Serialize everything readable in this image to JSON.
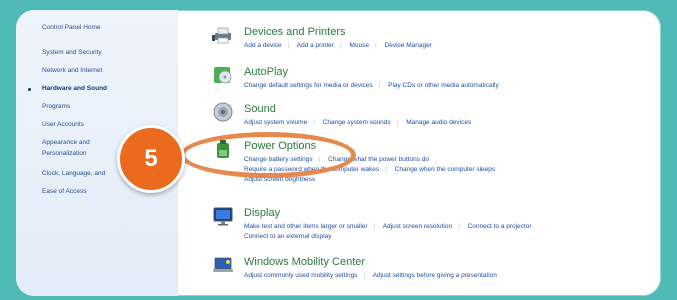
{
  "sidebar": {
    "items": [
      {
        "label": "Control Panel Home"
      },
      {
        "label": "System and Security"
      },
      {
        "label": "Network and Internet"
      },
      {
        "label": "Hardware and Sound"
      },
      {
        "label": "Programs"
      },
      {
        "label": "User Accounts"
      },
      {
        "label": "Appearance and"
      },
      {
        "label": "Personalization"
      },
      {
        "label": "Clock, Language, and"
      },
      {
        "label": "Ease of Access"
      }
    ]
  },
  "categories": [
    {
      "title": "Devices and Printers",
      "icon": "printer-icon",
      "links": [
        "Add a device",
        "Add a printer",
        "Mouse",
        "Device Manager"
      ]
    },
    {
      "title": "AutoPlay",
      "icon": "autoplay-icon",
      "links": [
        "Change default settings for media or devices",
        "Play CDs or other media automatically"
      ]
    },
    {
      "title": "Sound",
      "icon": "speaker-icon",
      "links": [
        "Adjust system volume",
        "Change system sounds",
        "Manage audio devices"
      ]
    },
    {
      "title": "Power Options",
      "icon": "battery-icon",
      "links": [
        "Change battery settings",
        "Change what the power buttons do"
      ],
      "links2": [
        "Require a password when the computer wakes",
        "Change when the computer sleeps"
      ],
      "links3": [
        "Adjust screen brightness"
      ]
    },
    {
      "title": "Display",
      "icon": "monitor-icon",
      "links": [
        "Make text and other items larger or smaller",
        "Adjust screen resolution",
        "Connect to a projector"
      ],
      "links2": [
        "Connect to an external display"
      ]
    },
    {
      "title": "Windows Mobility Center",
      "icon": "mobility-icon",
      "links": [
        "Adjust commonly used mobility settings",
        "Adjust settings before giving a presentation"
      ]
    }
  ],
  "annotation": {
    "step": "5"
  },
  "colors": {
    "accent": "#ec6a1e",
    "frame": "#4fb9b5",
    "ring": "#e48a4e"
  }
}
